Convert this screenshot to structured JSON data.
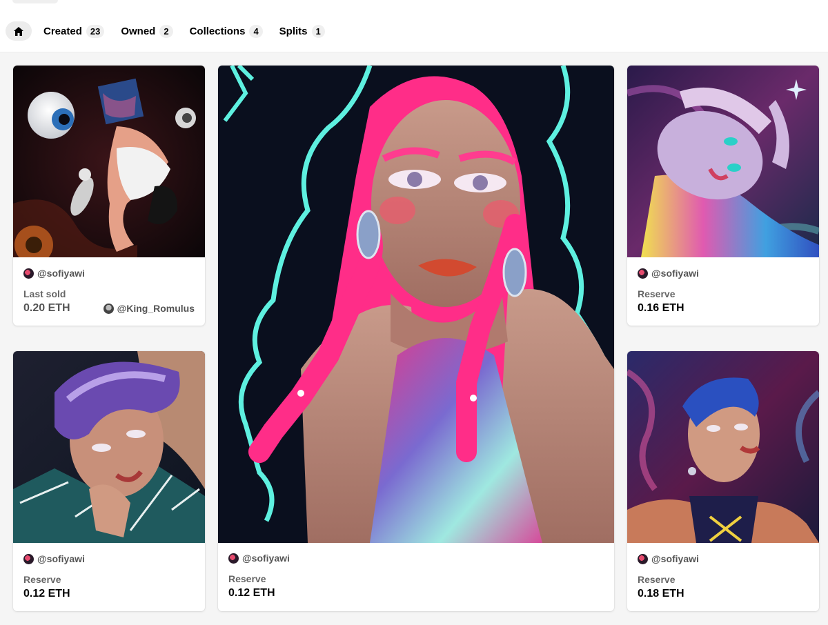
{
  "nav": {
    "home_icon": "home-icon",
    "tabs": [
      {
        "label": "Created",
        "count": "23"
      },
      {
        "label": "Owned",
        "count": "2"
      },
      {
        "label": "Collections",
        "count": "4"
      },
      {
        "label": "Splits",
        "count": "1"
      }
    ]
  },
  "cards": [
    {
      "creator": "@sofiyawi",
      "label": "Last sold",
      "price": "0.20 ETH",
      "owner": "@King_Romulus"
    },
    {
      "creator": "@sofiyawi",
      "label": "Reserve",
      "price": "0.12 ETH"
    },
    {
      "creator": "@sofiyawi",
      "label": "Reserve",
      "price": "0.16 ETH"
    },
    {
      "creator": "@sofiyawi",
      "label": "Reserve",
      "price": "0.12 ETH"
    },
    {
      "creator": "@sofiyawi",
      "label": "Reserve",
      "price": "0.18 ETH"
    }
  ],
  "colors": {
    "accent_pink": "#ff3c8f",
    "accent_cyan": "#5ef0e0",
    "dark_bg": "#0a0f1e"
  }
}
